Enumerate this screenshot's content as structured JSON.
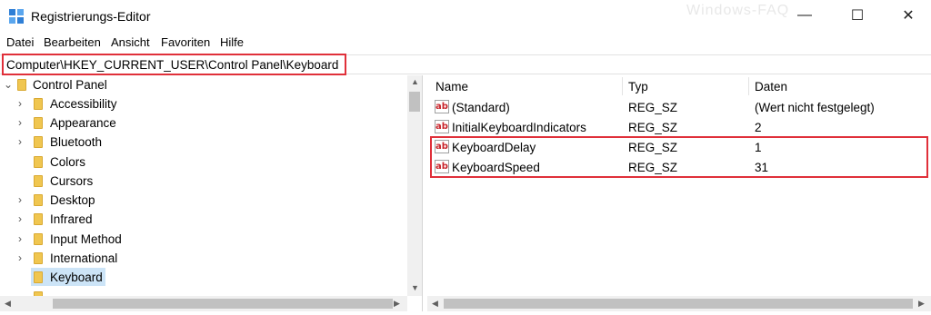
{
  "window": {
    "title": "Registrierungs-Editor",
    "watermark": "Windows-FAQ",
    "minimize_glyph": "—",
    "maximize_glyph": "☐",
    "close_glyph": "✕"
  },
  "menu": [
    "Datei",
    "Bearbeiten",
    "Ansicht",
    "Favoriten",
    "Hilfe"
  ],
  "address": {
    "path": "Computer\\HKEY_CURRENT_USER\\Control Panel\\Keyboard"
  },
  "tree": {
    "root": {
      "label": "Control Panel",
      "expanded": true
    },
    "items": [
      {
        "label": "Accessibility",
        "has_children": true
      },
      {
        "label": "Appearance",
        "has_children": true
      },
      {
        "label": "Bluetooth",
        "has_children": true
      },
      {
        "label": "Colors",
        "has_children": false
      },
      {
        "label": "Cursors",
        "has_children": false
      },
      {
        "label": "Desktop",
        "has_children": true
      },
      {
        "label": "Infrared",
        "has_children": true
      },
      {
        "label": "Input Method",
        "has_children": true
      },
      {
        "label": "International",
        "has_children": true
      },
      {
        "label": "Keyboard",
        "has_children": false,
        "selected": true
      }
    ]
  },
  "list": {
    "columns": [
      "Name",
      "Typ",
      "Daten"
    ],
    "rows": [
      {
        "name": "(Standard)",
        "type": "REG_SZ",
        "data": "(Wert nicht festgelegt)"
      },
      {
        "name": "InitialKeyboardIndicators",
        "type": "REG_SZ",
        "data": "2"
      },
      {
        "name": "KeyboardDelay",
        "type": "REG_SZ",
        "data": "1"
      },
      {
        "name": "KeyboardSpeed",
        "type": "REG_SZ",
        "data": "31"
      }
    ]
  },
  "icons": {
    "value_icon_text": "ab",
    "app_icon": "registry-editor-icon",
    "folder": "folder-icon"
  },
  "colors": {
    "highlight": "#e0303a",
    "selection": "#cce4f7",
    "folder": "#f0c650"
  }
}
